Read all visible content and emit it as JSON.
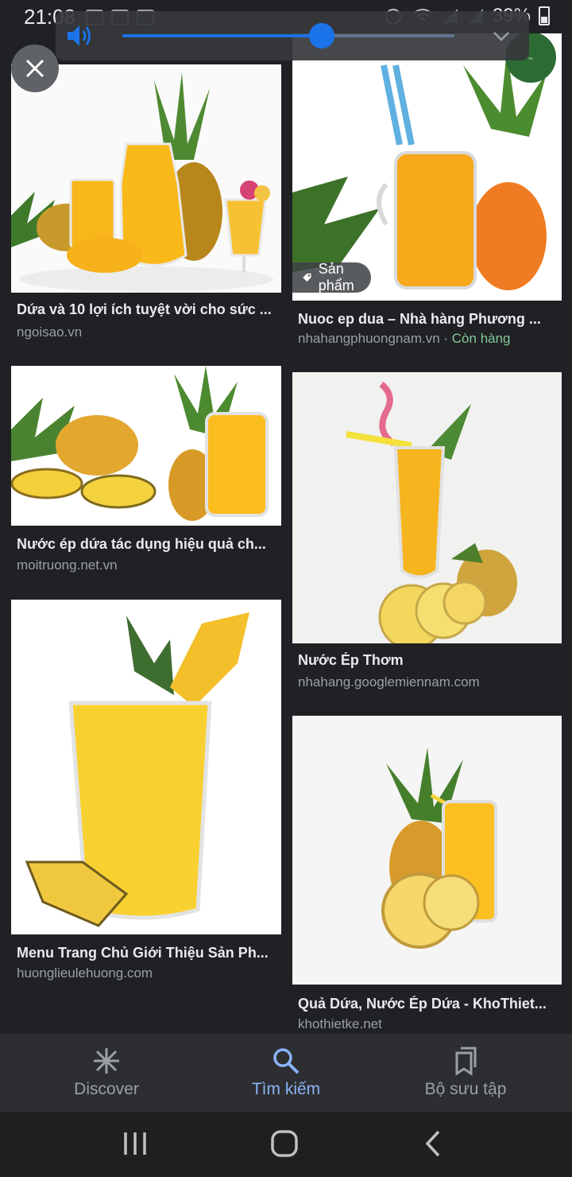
{
  "status_bar": {
    "time": "21:08",
    "battery": "39%"
  },
  "results": [
    {
      "title": "Dứa và 10 lợi ích tuyệt vời cho sức ...",
      "source": "ngoisao.vn"
    },
    {
      "title": "Nuoc ep dua – Nhà hàng Phương ...",
      "source": "nhahangphuongnam.vn",
      "source_extra": " · Còn hàng",
      "tag": "Sản phẩm"
    },
    {
      "title": "Nước ép dứa tác dụng hiệu quả ch...",
      "source": "moitruong.net.vn"
    },
    {
      "title": "Nước Ép Thơm",
      "source": "nhahang.googlemiennam.com"
    },
    {
      "title": "Menu Trang Chủ Giới Thiệu Sản Ph...",
      "source": "huonglieulehuong.com"
    },
    {
      "title": "Quả Dứa, Nước Ép Dứa - KhoThiet...",
      "source": "khothietke.net"
    }
  ],
  "volume": {
    "level": 0.6
  },
  "bottom_nav": {
    "items": [
      {
        "label": "Discover",
        "icon": "asterisk-icon"
      },
      {
        "label": "Tìm kiếm",
        "icon": "search-icon",
        "active": true
      },
      {
        "label": "Bộ sưu tập",
        "icon": "bookmarks-icon"
      }
    ]
  },
  "colors": {
    "accent": "#8ab4f8",
    "volume": "#1a73e8",
    "in_stock": "#81c995",
    "juice": "#f9b91a"
  }
}
